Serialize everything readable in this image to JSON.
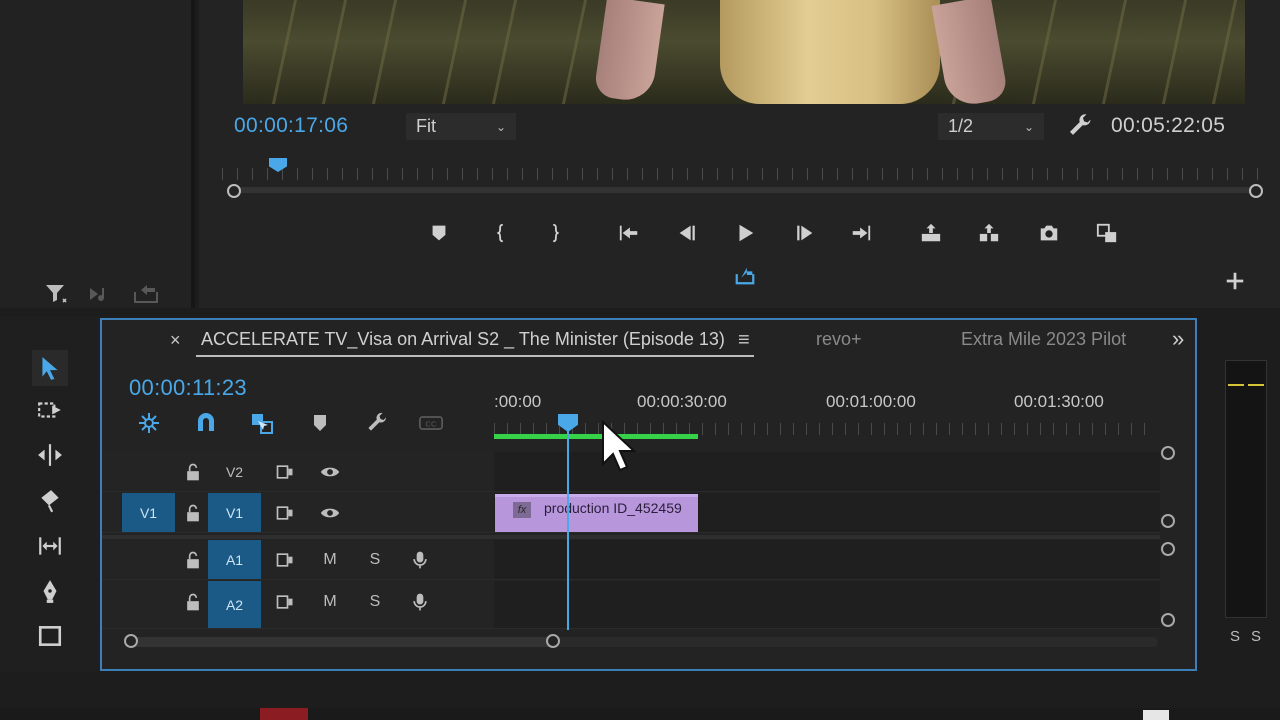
{
  "program_monitor": {
    "playhead_timecode": "00:00:17:06",
    "zoom_select": "Fit",
    "resolution_select": "1/2",
    "duration_timecode": "00:05:22:05"
  },
  "timeline": {
    "tabs": [
      {
        "label": "ACCELERATE TV_Visa on Arrival S2 _ The Minister (Episode 13)",
        "active": true
      },
      {
        "label": "revo+",
        "active": false
      },
      {
        "label": "Extra Mile 2023 Pilot",
        "active": false
      }
    ],
    "close_glyph": "×",
    "menu_glyph": "≡",
    "overflow_glyph": "»",
    "timecode": "00:00:11:23",
    "ruler_labels": [
      ":00:00",
      "00:00:30:00",
      "00:01:00:00",
      "00:01:30:00"
    ],
    "tracks": {
      "v2": {
        "label": "V2"
      },
      "v1": {
        "source": "V1",
        "label": "V1"
      },
      "a1": {
        "label": "A1",
        "mute": "M",
        "solo": "S"
      },
      "a2": {
        "label": "A2",
        "mute": "M",
        "solo": "S"
      }
    },
    "clip": {
      "name": "production ID_452459",
      "fx": "fx"
    }
  },
  "meter": {
    "solo_left": "S",
    "solo_right": "S"
  },
  "colors": {
    "accent": "#4aa8e8",
    "work_area": "#36d24a",
    "clip": "#b796dc",
    "track_target": "#1b5a86",
    "panel_border": "#3d7fb8"
  },
  "icons": {
    "filter": "filter-icon",
    "marker": "marker-icon",
    "in_point": "mark-in-icon",
    "out_point": "mark-out-icon",
    "go_in": "go-to-in-icon",
    "step_back": "step-back-icon",
    "play": "play-icon",
    "step_forward": "step-forward-icon",
    "go_out": "go-to-out-icon",
    "lift": "lift-icon",
    "extract": "extract-icon",
    "export_frame": "camera-icon",
    "compare": "comparison-view-icon",
    "export": "export-icon",
    "add": "add-button-icon"
  }
}
